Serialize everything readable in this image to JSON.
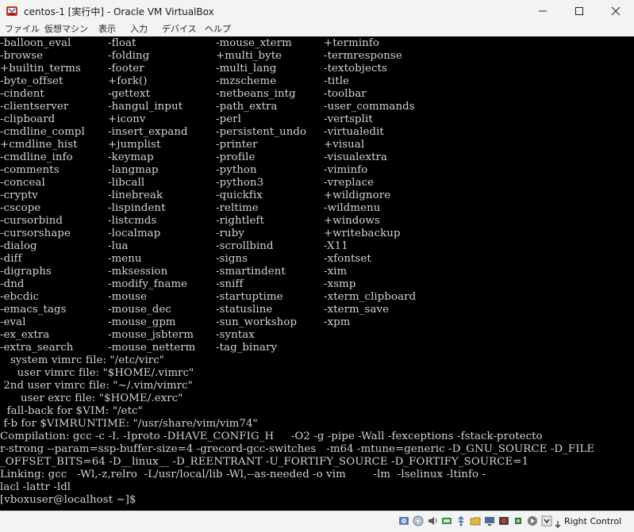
{
  "window": {
    "title": "centos-1 [実行中] - Oracle VM VirtualBox"
  },
  "menu": {
    "items": [
      {
        "label": "ファイル"
      },
      {
        "label": "仮想マシン"
      },
      {
        "label": "表示"
      },
      {
        "label": "入力"
      },
      {
        "label": "デバイス"
      },
      {
        "label": "ヘルプ"
      }
    ]
  },
  "terminal": {
    "feature_rows": [
      [
        "-balloon_eval",
        "-float",
        "-mouse_xterm",
        "+terminfo"
      ],
      [
        "-browse",
        "-folding",
        "+multi_byte",
        "-termresponse"
      ],
      [
        "+builtin_terms",
        "-footer",
        "-multi_lang",
        "-textobjects"
      ],
      [
        "-byte_offset",
        "+fork()",
        "-mzscheme",
        "-title"
      ],
      [
        "-cindent",
        "-gettext",
        "-netbeans_intg",
        "-toolbar"
      ],
      [
        "-clientserver",
        "-hangul_input",
        "-path_extra",
        "-user_commands"
      ],
      [
        "-clipboard",
        "+iconv",
        "-perl",
        "-vertsplit"
      ],
      [
        "-cmdline_compl",
        "-insert_expand",
        "-persistent_undo",
        "-virtualedit"
      ],
      [
        "+cmdline_hist",
        "+jumplist",
        "-printer",
        "+visual"
      ],
      [
        "-cmdline_info",
        "-keymap",
        "-profile",
        "-visualextra"
      ],
      [
        "-comments",
        "-langmap",
        "-python",
        "-viminfo"
      ],
      [
        "-conceal",
        "-libcall",
        "-python3",
        "-vreplace"
      ],
      [
        "-cryptv",
        "-linebreak",
        "-quickfix",
        "+wildignore"
      ],
      [
        "-cscope",
        "-lispindent",
        "-reltime",
        "-wildmenu"
      ],
      [
        "-cursorbind",
        "-listcmds",
        "-rightleft",
        "+windows"
      ],
      [
        "-cursorshape",
        "-localmap",
        "-ruby",
        "+writebackup"
      ],
      [
        "-dialog",
        "-lua",
        "-scrollbind",
        "-X11"
      ],
      [
        "-diff",
        "-menu",
        "-signs",
        "-xfontset"
      ],
      [
        "-digraphs",
        "-mksession",
        "-smartindent",
        "-xim"
      ],
      [
        "-dnd",
        "-modify_fname",
        "-sniff",
        "-xsmp"
      ],
      [
        "-ebcdic",
        "-mouse",
        "-startuptime",
        "-xterm_clipboard"
      ],
      [
        "-emacs_tags",
        "-mouse_dec",
        "-statusline",
        "-xterm_save"
      ],
      [
        "-eval",
        "-mouse_gpm",
        "-sun_workshop",
        "-xpm"
      ],
      [
        "-ex_extra",
        "-mouse_jsbterm",
        "-syntax",
        ""
      ],
      [
        "-extra_search",
        "-mouse_netterm",
        "-tag_binary",
        ""
      ]
    ],
    "info_lines": [
      "   system vimrc file: \"/etc/virc\"",
      "     user vimrc file: \"$HOME/.vimrc\"",
      " 2nd user vimrc file: \"~/.vim/vimrc\"",
      "      user exrc file: \"$HOME/.exrc\"",
      "  fall-back for $VIM: \"/etc\"",
      " f-b for $VIMRUNTIME: \"/usr/share/vim/vim74\"",
      "Compilation: gcc -c -I. -Iproto -DHAVE_CONFIG_H     -O2 -g -pipe -Wall -fexceptions -fstack-protecto",
      "r-strong --param=ssp-buffer-size=4 -grecord-gcc-switches   -m64 -mtune=generic -D_GNU_SOURCE -D_FILE",
      "_OFFSET_BITS=64 -D__linux__ -D_REENTRANT -U_FORTIFY_SOURCE -D_FORTIFY_SOURCE=1",
      "Linking: gcc   -Wl,-z,relro  -L/usr/local/lib -Wl,--as-needed -o vim        -lm  -lselinux -ltinfo -",
      "lacl -lattr -ldl",
      "[vboxuser@localhost ~]$"
    ]
  },
  "status": {
    "host_key_label": "Right Control",
    "icons": [
      "hard-disk-icon",
      "optical-drive-icon",
      "audio-icon",
      "network-icon",
      "usb-icon",
      "shared-folders-icon",
      "display-icon",
      "recording-icon",
      "cpu-icon",
      "mouse-integration-icon",
      "arrow-down-icon"
    ]
  },
  "colors": {
    "terminal_bg": "#000000",
    "terminal_fg": "#d4d4d4",
    "chrome_bg": "#f3f3f3"
  }
}
